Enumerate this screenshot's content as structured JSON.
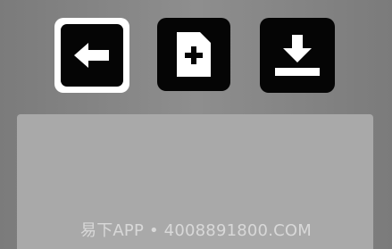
{
  "toolbar": {
    "buttons": [
      {
        "name": "back",
        "icon": "arrow-left-icon",
        "selected": true
      },
      {
        "name": "new-document",
        "icon": "file-plus-icon",
        "selected": false
      },
      {
        "name": "download",
        "icon": "download-icon",
        "selected": false
      }
    ]
  },
  "colors": {
    "background": "#858585",
    "button_fill": "#050505",
    "selected_border": "#ffffff",
    "panel": "#a9a9a9"
  },
  "watermark": {
    "text": "易下APP • 4008891800.COM"
  }
}
